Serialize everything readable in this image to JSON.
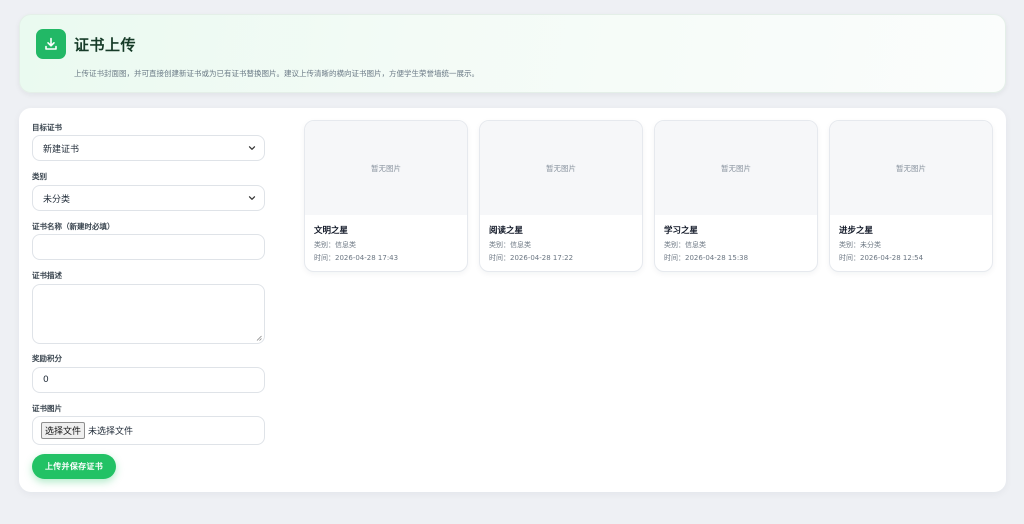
{
  "header": {
    "title": "证书上传",
    "description": "上传证书封面图，并可直接创建新证书或为已有证书替换图片。建议上传清晰的横向证书图片，方便学生荣誉墙统一展示。"
  },
  "form": {
    "target_label": "目标证书",
    "target_value": "新建证书",
    "category_label": "类别",
    "category_value": "未分类",
    "name_label": "证书名称（新建时必填）",
    "name_value": "",
    "desc_label": "证书描述",
    "desc_value": "",
    "points_label": "奖励积分",
    "points_value": "0",
    "image_label": "证书图片",
    "file_button": "选择文件",
    "file_status": "未选择文件",
    "submit_label": "上传并保存证书"
  },
  "cards": [
    {
      "image_placeholder": "暂无图片",
      "title": "文明之星",
      "category": "类别：信息类",
      "time": "时间：2026-04-28 17:43"
    },
    {
      "image_placeholder": "暂无图片",
      "title": "阅读之星",
      "category": "类别：信息类",
      "time": "时间：2026-04-28 17:22"
    },
    {
      "image_placeholder": "暂无图片",
      "title": "学习之星",
      "category": "类别：信息类",
      "time": "时间：2026-04-28 15:38"
    },
    {
      "image_placeholder": "暂无图片",
      "title": "进步之星",
      "category": "类别：未分类",
      "time": "时间：2026-04-28 12:54"
    }
  ],
  "icons": {
    "header_icon": "download-icon",
    "select_arrow": "chevron-down-icon"
  },
  "colors": {
    "accent": "#22c265",
    "icon_bg": "#22b866"
  }
}
